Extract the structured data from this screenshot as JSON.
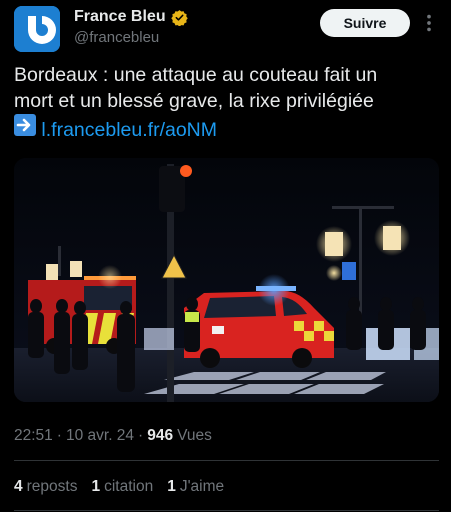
{
  "author": {
    "display_name": "France Bleu",
    "handle": "@francebleu",
    "verified": true,
    "avatar_color": "#1d7fd1"
  },
  "follow_label": "Suivre",
  "tweet": {
    "line1": "Bordeaux : une attaque au couteau fait un",
    "line2": "mort et un blessé grave, la rixe privilégiée",
    "link_text": "l.francebleu.fr/aoNM",
    "link_color": "#1d9bf0"
  },
  "media": {
    "icon": "photo-night-street-emergency-vehicles"
  },
  "meta": {
    "time": "22:51",
    "sep1": "·",
    "date": "10 avr. 24",
    "sep2": "·",
    "views_count": "946",
    "views_label": "Vues"
  },
  "stats": {
    "reposts_count": "4",
    "reposts_label": "reposts",
    "quotes_count": "1",
    "quotes_label": "citation",
    "likes_count": "1",
    "likes_label": "J'aime"
  }
}
